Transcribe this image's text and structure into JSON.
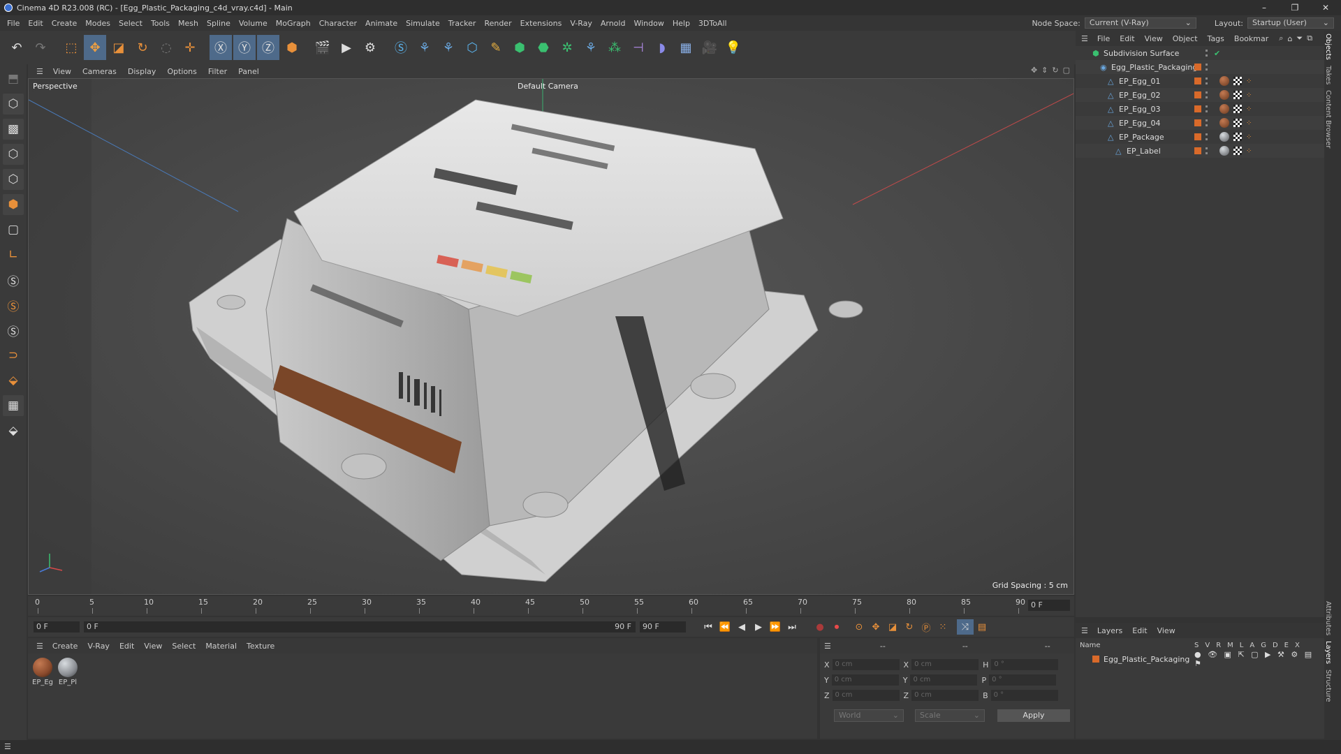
{
  "window": {
    "title": "Cinema 4D R23.008 (RC) - [Egg_Plastic_Packaging_c4d_vray.c4d] - Main",
    "controls": [
      "–",
      "❐",
      "✕"
    ]
  },
  "menu": [
    "File",
    "Edit",
    "Create",
    "Modes",
    "Select",
    "Tools",
    "Mesh",
    "Spline",
    "Volume",
    "MoGraph",
    "Character",
    "Animate",
    "Simulate",
    "Tracker",
    "Render",
    "Extensions",
    "V-Ray",
    "Arnold",
    "Window",
    "Help",
    "3DToAll"
  ],
  "nodespace": {
    "label": "Node Space:",
    "value": "Current (V-Ray)",
    "layout_label": "Layout:",
    "layout_value": "Startup (User)"
  },
  "viewport": {
    "menu": [
      "View",
      "Cameras",
      "Display",
      "Options",
      "Filter",
      "Panel"
    ],
    "label": "Perspective",
    "camera": "Default Camera",
    "grid_spacing": "Grid Spacing : 5 cm"
  },
  "timeline": {
    "ticks": [
      "0",
      "5",
      "10",
      "15",
      "20",
      "25",
      "30",
      "35",
      "40",
      "45",
      "50",
      "55",
      "60",
      "65",
      "70",
      "75",
      "80",
      "85",
      "90"
    ],
    "current_frame": "0 F"
  },
  "transport": {
    "start": "0 F",
    "current": "0 F",
    "end": "90 F",
    "max": "90 F"
  },
  "materials": {
    "menu": [
      "Create",
      "V-Ray",
      "Edit",
      "View",
      "Select",
      "Material",
      "Texture"
    ],
    "items": [
      {
        "label": "EP_Eg",
        "color": "#8a4a2c"
      },
      {
        "label": "EP_Pl",
        "color": "#8a8d92"
      }
    ]
  },
  "coords": {
    "header": [
      "--",
      "--",
      "--"
    ],
    "rows": [
      {
        "a": "X",
        "av": "0 cm",
        "b": "X",
        "bv": "0 cm",
        "c": "H",
        "cv": "0 °"
      },
      {
        "a": "Y",
        "av": "0 cm",
        "b": "Y",
        "bv": "0 cm",
        "c": "P",
        "cv": "0 °"
      },
      {
        "a": "Z",
        "av": "0 cm",
        "b": "Z",
        "bv": "0 cm",
        "c": "B",
        "cv": "0 °"
      }
    ],
    "world": "World",
    "scale": "Scale",
    "apply": "Apply"
  },
  "objects": {
    "menu": [
      "File",
      "Edit",
      "View",
      "Object",
      "Tags",
      "Bookmar"
    ],
    "items": [
      {
        "name": "Subdivision Surface",
        "indent": 0
      },
      {
        "name": "Egg_Plastic_Packaging",
        "indent": 1
      },
      {
        "name": "EP_Egg_01",
        "indent": 2
      },
      {
        "name": "EP_Egg_02",
        "indent": 2
      },
      {
        "name": "EP_Egg_03",
        "indent": 2
      },
      {
        "name": "EP_Egg_04",
        "indent": 2
      },
      {
        "name": "EP_Package",
        "indent": 2
      },
      {
        "name": "EP_Label",
        "indent": 3
      }
    ]
  },
  "layers": {
    "menu": [
      "Layers",
      "Edit",
      "View"
    ],
    "header_name": "Name",
    "cols": [
      "S",
      "V",
      "R",
      "M",
      "L",
      "A",
      "G",
      "D",
      "E",
      "X"
    ],
    "items": [
      "Egg_Plastic_Packaging"
    ]
  },
  "side_tabs": [
    "Objects",
    "Takes",
    "Content Browser",
    "Attributes",
    "Layers",
    "Structure"
  ]
}
